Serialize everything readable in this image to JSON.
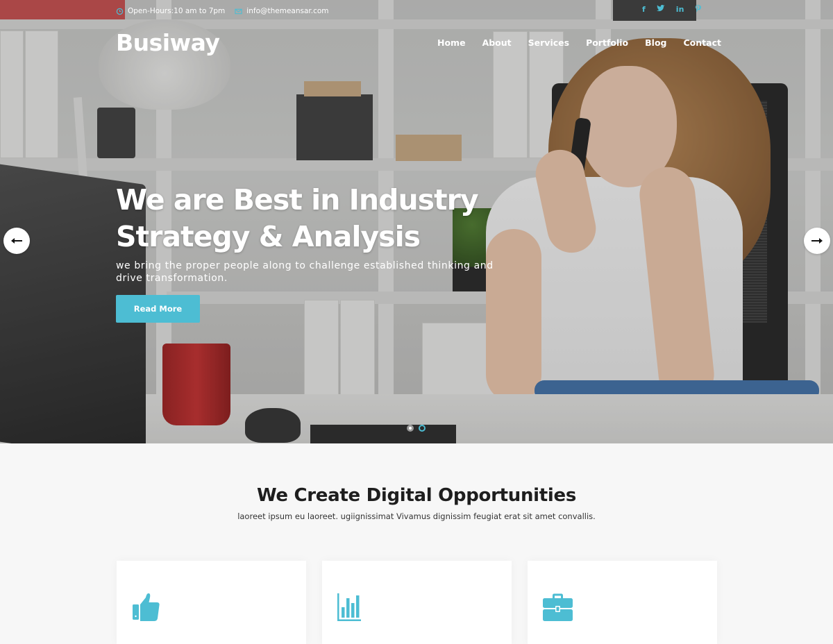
{
  "topbar": {
    "hours": "Open-Hours:10 am to 7pm",
    "email": "info@themeansar.com",
    "hours_icon": "clock-icon",
    "email_icon": "envelope-icon",
    "social": [
      {
        "name": "facebook",
        "glyph": "f"
      },
      {
        "name": "twitter",
        "glyph": "t"
      },
      {
        "name": "linkedin",
        "glyph": "in"
      },
      {
        "name": "pinterest",
        "glyph": "p"
      }
    ]
  },
  "header": {
    "logo": "Busiway",
    "nav": [
      "Home",
      "About",
      "Services",
      "Portfolio",
      "Blog",
      "Contact"
    ]
  },
  "hero": {
    "title_line1": "We are Best in Industry",
    "title_line2": "Strategy & Analysis",
    "subtitle": "we bring the proper people along to challenge established thinking and drive transformation.",
    "button": "Read More",
    "prev_icon": "arrow-left-icon",
    "next_icon": "arrow-right-icon",
    "slides_total": 2,
    "active_slide": 1
  },
  "section": {
    "title": "We Create Digital Opportunities",
    "subtitle": "laoreet ipsum eu laoreet. ugiignissimat Vivamus dignissim feugiat erat sit amet convallis.",
    "cards": [
      {
        "icon": "thumbs-up-icon"
      },
      {
        "icon": "bar-chart-icon"
      },
      {
        "icon": "briefcase-icon"
      }
    ]
  },
  "colors": {
    "accent": "#4dbdd3",
    "text_dark": "#1e1e1e",
    "white": "#ffffff"
  }
}
